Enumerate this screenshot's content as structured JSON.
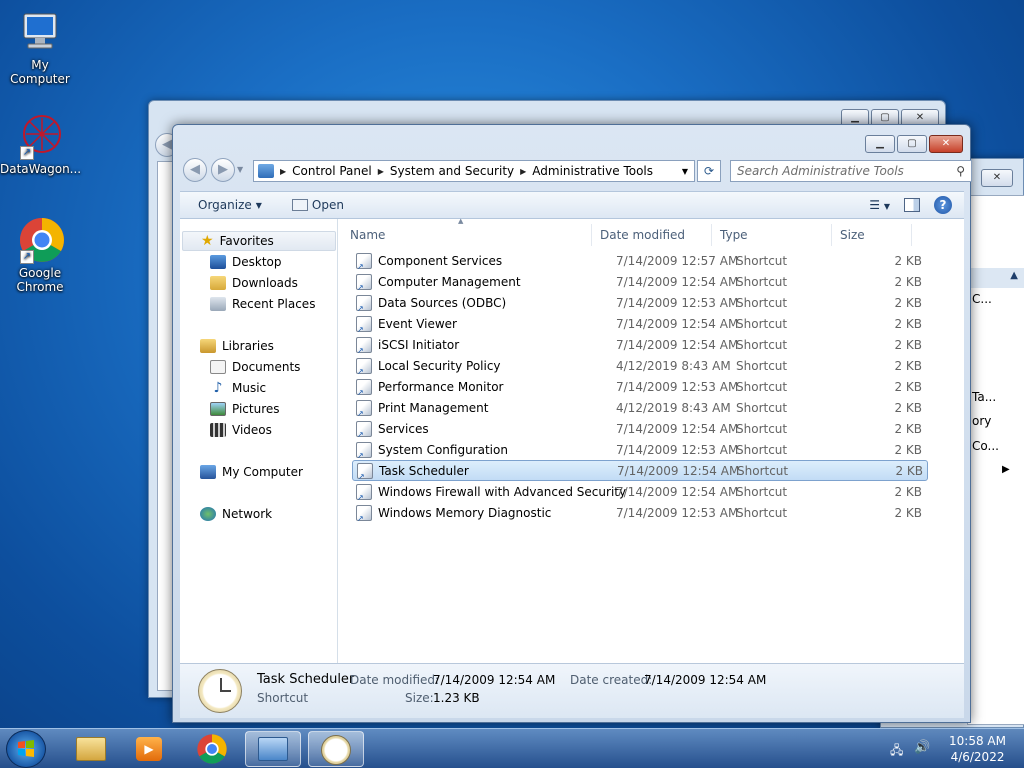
{
  "desktop": {
    "icons": [
      {
        "label": "My Computer"
      },
      {
        "label": "DataWagon..."
      },
      {
        "label": "Google Chrome"
      }
    ]
  },
  "window": {
    "breadcrumb": [
      "Control Panel",
      "System and Security",
      "Administrative Tools"
    ],
    "search_placeholder": "Search Administrative Tools",
    "toolbar": {
      "organize": "Organize",
      "open": "Open"
    },
    "nav": {
      "favorites": {
        "label": "Favorites",
        "items": [
          "Desktop",
          "Downloads",
          "Recent Places"
        ]
      },
      "libraries": {
        "label": "Libraries",
        "items": [
          "Documents",
          "Music",
          "Pictures",
          "Videos"
        ]
      },
      "computer": "My Computer",
      "network": "Network"
    },
    "columns": [
      "Name",
      "Date modified",
      "Type",
      "Size"
    ],
    "files": [
      {
        "name": "Component Services",
        "date": "7/14/2009 12:57 AM",
        "type": "Shortcut",
        "size": "2 KB"
      },
      {
        "name": "Computer Management",
        "date": "7/14/2009 12:54 AM",
        "type": "Shortcut",
        "size": "2 KB"
      },
      {
        "name": "Data Sources (ODBC)",
        "date": "7/14/2009 12:53 AM",
        "type": "Shortcut",
        "size": "2 KB"
      },
      {
        "name": "Event Viewer",
        "date": "7/14/2009 12:54 AM",
        "type": "Shortcut",
        "size": "2 KB"
      },
      {
        "name": "iSCSI Initiator",
        "date": "7/14/2009 12:54 AM",
        "type": "Shortcut",
        "size": "2 KB"
      },
      {
        "name": "Local Security Policy",
        "date": "4/12/2019 8:43 AM",
        "type": "Shortcut",
        "size": "2 KB"
      },
      {
        "name": "Performance Monitor",
        "date": "7/14/2009 12:53 AM",
        "type": "Shortcut",
        "size": "2 KB"
      },
      {
        "name": "Print Management",
        "date": "4/12/2019 8:43 AM",
        "type": "Shortcut",
        "size": "2 KB"
      },
      {
        "name": "Services",
        "date": "7/14/2009 12:54 AM",
        "type": "Shortcut",
        "size": "2 KB"
      },
      {
        "name": "System Configuration",
        "date": "7/14/2009 12:53 AM",
        "type": "Shortcut",
        "size": "2 KB"
      },
      {
        "name": "Task Scheduler",
        "date": "7/14/2009 12:54 AM",
        "type": "Shortcut",
        "size": "2 KB"
      },
      {
        "name": "Windows Firewall with Advanced Security",
        "date": "7/14/2009 12:54 AM",
        "type": "Shortcut",
        "size": "2 KB"
      },
      {
        "name": "Windows Memory Diagnostic",
        "date": "7/14/2009 12:53 AM",
        "type": "Shortcut",
        "size": "2 KB"
      }
    ],
    "selected_index": 10,
    "details": {
      "name": "Task Scheduler",
      "kind": "Shortcut",
      "date_modified_label": "Date modified:",
      "date_modified": "7/14/2009 12:54 AM",
      "date_created_label": "Date created:",
      "date_created": "7/14/2009 12:54 AM",
      "size_label": "Size:",
      "size": "1.23 KB"
    }
  },
  "background_window": {
    "fragments": [
      "C...",
      "Ta...",
      "ory",
      "Co..."
    ]
  },
  "taskbar": {
    "time": "10:58 AM",
    "date": "4/6/2022"
  },
  "colors": {
    "selection": "#c2dcf5",
    "desktop": "#1a6ec4"
  }
}
